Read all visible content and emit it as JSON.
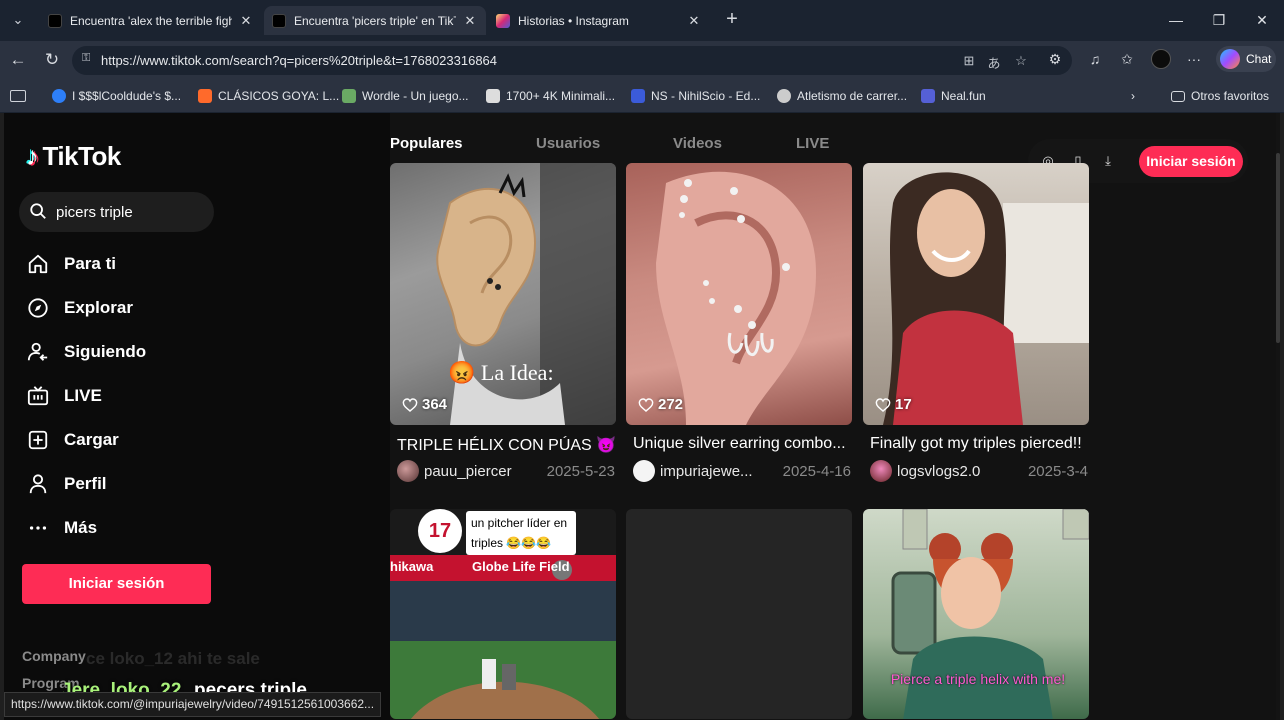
{
  "browser": {
    "tabs": [
      {
        "title": "Encuentra 'alex the terrible fight' e",
        "favicon_color": "#000000",
        "active": false
      },
      {
        "title": "Encuentra 'picers triple' en TikTok",
        "favicon_color": "#000000",
        "active": true
      },
      {
        "title": "Historias • Instagram",
        "favicon_color": "#e1306c",
        "active": false
      }
    ],
    "url": "https://www.tiktok.com/search?q=picers%20triple&t=1768023316864",
    "copilot_label": "Chat",
    "bookmarks": [
      {
        "label": "I $$$lCooldude's $...",
        "color": "#2d7ff9"
      },
      {
        "label": "CLÁSICOS GOYA: L...",
        "color": "#ff6a2b"
      },
      {
        "label": "Wordle - Un juego...",
        "color": "#6aaa64"
      },
      {
        "label": "1700+ 4K Minimali...",
        "color": "#dddddd"
      },
      {
        "label": "NS - NihilScio - Ed...",
        "color": "#3b5bd9"
      },
      {
        "label": "Atletismo de carrer...",
        "color": "#cccccc"
      },
      {
        "label": "Neal.fun",
        "color": "#5560d6"
      }
    ],
    "other_bookmarks": "Otros favoritos",
    "status_url": "https://www.tiktok.com/@impuriajewelry/video/7491512561003662..."
  },
  "tiktok": {
    "brand": "TikTok",
    "search_value": "picers triple",
    "nav": [
      {
        "label": "Para ti",
        "icon": "home-icon"
      },
      {
        "label": "Explorar",
        "icon": "compass-icon"
      },
      {
        "label": "Siguiendo",
        "icon": "following-icon"
      },
      {
        "label": "LIVE",
        "icon": "live-icon"
      },
      {
        "label": "Cargar",
        "icon": "upload-icon"
      },
      {
        "label": "Perfil",
        "icon": "profile-icon"
      },
      {
        "label": "Más",
        "icon": "more-icon"
      }
    ],
    "login_label": "Iniciar sesión",
    "footer": [
      "Company",
      "Program"
    ],
    "ghost_text": "ce loko_12 ahi te sale",
    "content_tabs": [
      "Populares",
      "Usuarios",
      "Videos",
      "LIVE"
    ],
    "header_login": "Iniciar sesión",
    "accent": "#fe2c55",
    "videos": [
      {
        "likes": "364",
        "title": "TRIPLE HÉLIX CON PÚAS 😈",
        "user": "pauu_piercer",
        "date": "2025-5-23",
        "caption": "😡 La Idea:"
      },
      {
        "likes": "272",
        "title": "Unique silver earring combo...",
        "user": "impuriajewe...",
        "date": "2025-4-16"
      },
      {
        "likes": "17",
        "title": "Finally got my triples pierced!!",
        "user": "logsvlogs2.0",
        "date": "2025-3-4"
      }
    ],
    "row2": [
      {
        "caption": "un pitcher líder en triples 😂😂😂",
        "badge_number": "17",
        "banner": "Globe Life Field",
        "banner_left": "hikawa"
      },
      {
        "caption": ""
      },
      {
        "caption": "Pierce a triple helix with me!"
      }
    ]
  },
  "stream_overlay": {
    "user": "Jere_loko_22",
    "message": "pecers triple"
  }
}
